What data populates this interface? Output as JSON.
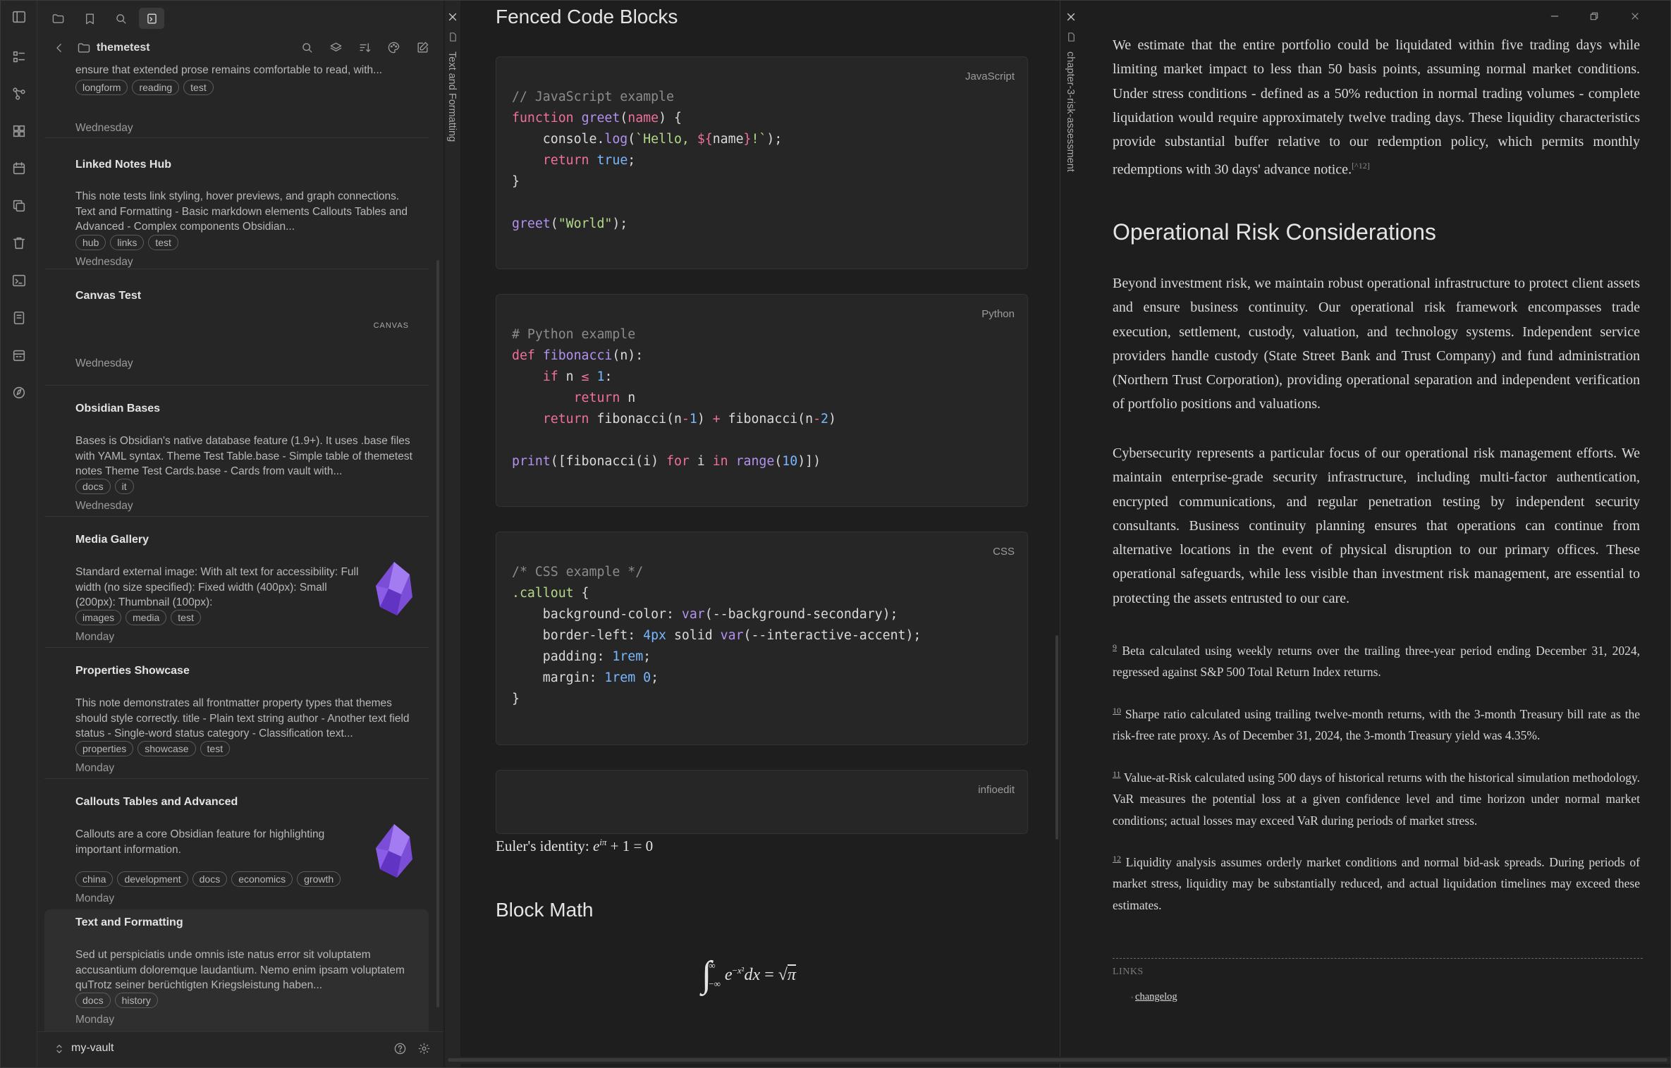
{
  "sidebar": {
    "folder_title": "themetest",
    "notes": [
      {
        "title": "",
        "preview": "ensure that extended prose remains comfortable to read, with...",
        "tags": [
          "longform",
          "reading",
          "test"
        ],
        "date": "Wednesday"
      },
      {
        "title": "Linked Notes Hub",
        "preview": "This note tests link styling, hover previews, and graph connections. Text and Formatting - Basic markdown elements Callouts Tables and Advanced - Complex components Obsidian...",
        "tags": [
          "hub",
          "links",
          "test"
        ],
        "date": "Wednesday"
      },
      {
        "title": "Canvas Test",
        "preview": "",
        "badge": "CANVAS",
        "tags": [],
        "date": "Wednesday"
      },
      {
        "title": "Obsidian Bases",
        "preview": "Bases is Obsidian's native database feature (1.9+). It uses .base files with YAML syntax. Theme Test Table.base - Simple table of themetest notes Theme Test Cards.base - Cards from vault with...",
        "tags": [
          "docs",
          "it"
        ],
        "date": "Wednesday"
      },
      {
        "title": "Media Gallery",
        "preview": "Standard external image: With alt text for accessibility: Full width (no size specified): Fixed width (400px): Small (200px): Thumbnail (100px):",
        "tags": [
          "images",
          "media",
          "test"
        ],
        "date": "Monday"
      },
      {
        "title": "Properties Showcase",
        "preview": "This note demonstrates all frontmatter property types that themes should style correctly. title - Plain text string author - Another text field status - Single-word status category - Classification text...",
        "tags": [
          "properties",
          "showcase",
          "test"
        ],
        "date": "Monday"
      },
      {
        "title": "Callouts Tables and Advanced",
        "preview": "Callouts are a core Obsidian feature for highlighting important information.",
        "tags": [
          "china",
          "development",
          "docs",
          "economics",
          "growth"
        ],
        "date": "Monday"
      },
      {
        "title": "Text and Formatting",
        "preview": "Sed ut perspiciatis unde omnis iste natus error sit voluptatem accusantium doloremque laudantium. Nemo enim ipsam voluptatem quTrotz seiner berüchtigten Kriegsleistung haben...",
        "tags": [
          "docs",
          "history"
        ],
        "date": "Monday"
      }
    ],
    "vault_name": "my-vault"
  },
  "middle": {
    "tab_title": "Text and Formatting",
    "heading_code": "Fenced Code Blocks",
    "code_blocks": [
      {
        "lang": "JavaScript"
      },
      {
        "lang": "Python"
      },
      {
        "lang": "CSS"
      },
      {
        "lang": "infioedit"
      }
    ],
    "euler_label": "Euler's identity:",
    "heading_math": "Block Math"
  },
  "right": {
    "tab_title": "chapter-3-risk-assessment",
    "para1": "We estimate that the entire portfolio could be liquidated within five trading days while limiting market impact to less than 50 basis points, assuming normal market conditions. Under stress conditions - defined as a 50% reduction in normal trading volumes - complete liquidation would require approximately twelve trading days. These liquidity characteristics provide substantial buffer relative to our redemption policy, which permits monthly redemptions with 30 days' advance notice.",
    "para1_ref": "[^12]",
    "heading": "Operational Risk Considerations",
    "para2": "Beyond investment risk, we maintain robust operational infrastructure to protect client assets and ensure business continuity. Our operational risk framework encompasses trade execution, settlement, custody, valuation, and technology systems. Independent service providers handle custody (State Street Bank and Trust Company) and fund administration (Northern Trust Corporation), providing operational separation and independent verification of portfolio positions and valuations.",
    "para3": "Cybersecurity represents a particular focus of our operational risk management efforts. We maintain enterprise-grade security infrastructure, including multi-factor authentication, encrypted communications, and regular penetration testing by independent security consultants. Business continuity planning ensures that operations can continue from alternative locations in the event of physical disruption to our primary offices. These operational safeguards, while less visible than investment risk management, are essential to protecting the assets entrusted to our care.",
    "footnotes": [
      {
        "n": "9",
        "text": "Beta calculated using weekly returns over the trailing three-year period ending December 31, 2024, regressed against S&P 500 Total Return Index returns."
      },
      {
        "n": "10",
        "text": "Sharpe ratio calculated using trailing twelve-month returns, with the 3-month Treasury bill rate as the risk-free rate proxy. As of December 31, 2024, the 3-month Treasury yield was 4.35%."
      },
      {
        "n": "11",
        "text": "Value-at-Risk calculated using 500 days of historical returns with the historical simulation methodology. VaR measures the potential loss at a given confidence level and time horizon under normal market conditions; actual losses may exceed VaR during periods of market stress."
      },
      {
        "n": "12",
        "text": "Liquidity analysis assumes orderly market conditions and normal bid-ask spreads. During periods of market stress, liquidity may be substantially reduced, and actual liquidation timelines may exceed these estimates."
      }
    ],
    "links_label": "LINKS",
    "link_item": "changelog"
  }
}
